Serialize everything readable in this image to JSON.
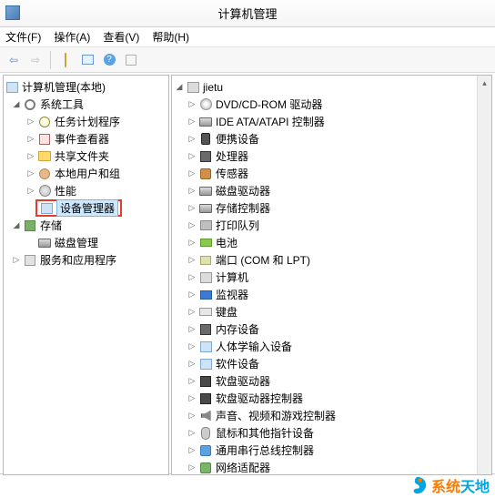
{
  "window": {
    "title": "计算机管理"
  },
  "menu": {
    "file": "文件(F)",
    "action": "操作(A)",
    "view": "查看(V)",
    "help": "帮助(H)"
  },
  "left_tree": {
    "root": "计算机管理(本地)",
    "system_tools": "系统工具",
    "task_scheduler": "任务计划程序",
    "event_viewer": "事件查看器",
    "shared_folders": "共享文件夹",
    "local_users": "本地用户和组",
    "performance": "性能",
    "device_manager": "设备管理器",
    "storage": "存储",
    "disk_mgmt": "磁盘管理",
    "services_apps": "服务和应用程序"
  },
  "right_tree": {
    "root": "jietu",
    "items": [
      "DVD/CD-ROM 驱动器",
      "IDE ATA/ATAPI 控制器",
      "便携设备",
      "处理器",
      "传感器",
      "磁盘驱动器",
      "存储控制器",
      "打印队列",
      "电池",
      "端口 (COM 和 LPT)",
      "计算机",
      "监视器",
      "键盘",
      "内存设备",
      "人体学输入设备",
      "软件设备",
      "软盘驱动器",
      "软盘驱动器控制器",
      "声音、视频和游戏控制器",
      "鼠标和其他指针设备",
      "通用串行总线控制器",
      "网络适配器"
    ]
  },
  "watermark": {
    "t1": "系统",
    "t2": "天地"
  }
}
